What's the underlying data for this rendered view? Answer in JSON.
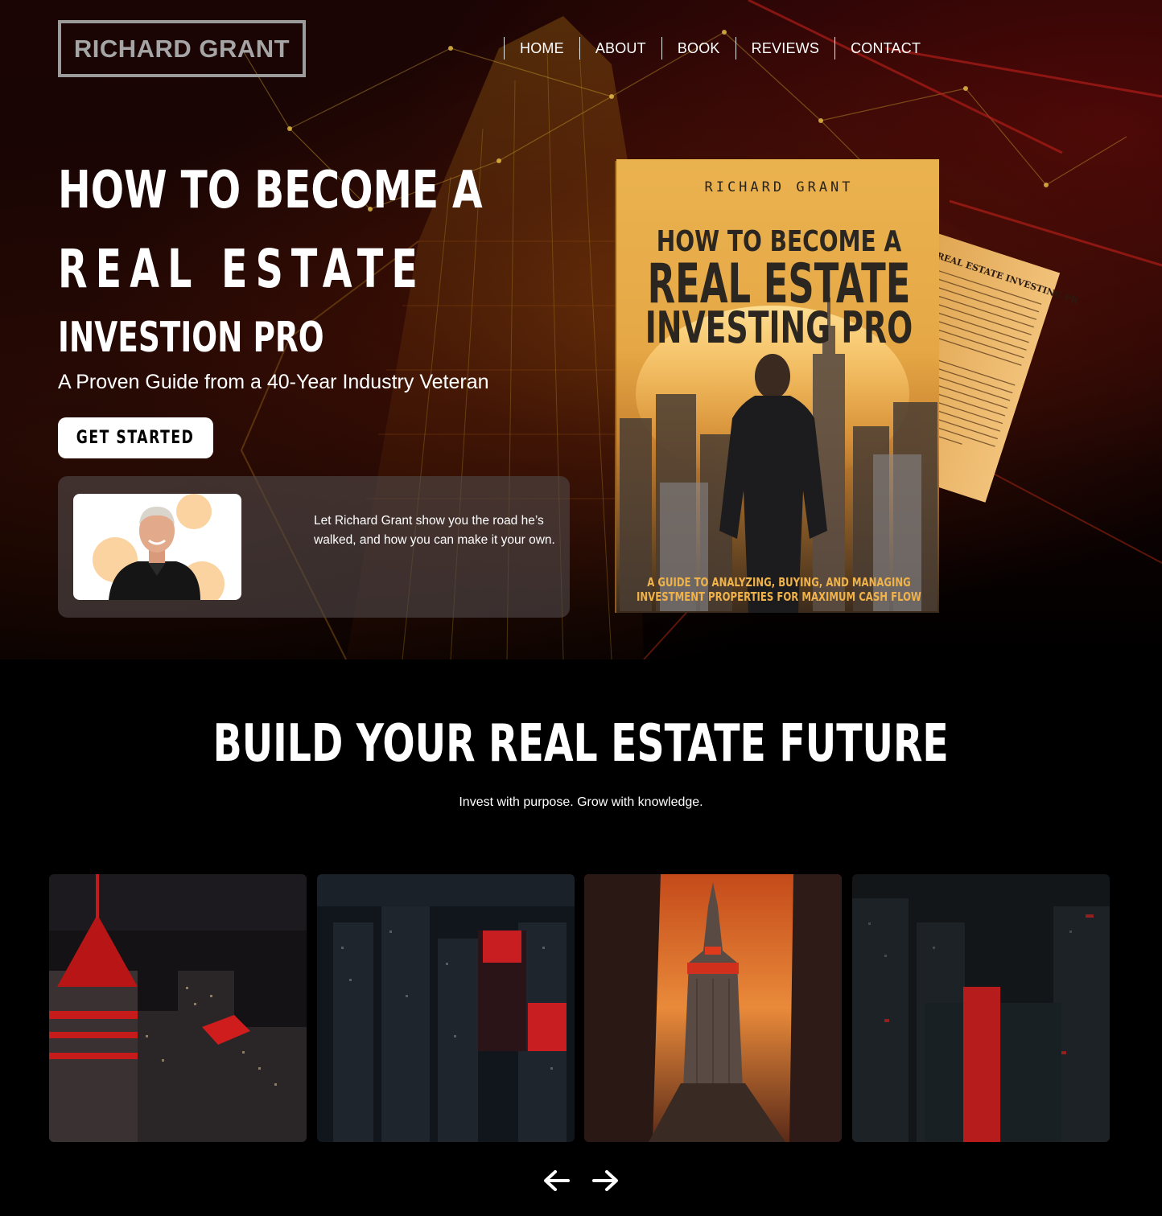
{
  "brand": {
    "logo_text": "RICHARD GRANT"
  },
  "nav": {
    "items": [
      {
        "label": "HOME"
      },
      {
        "label": "ABOUT"
      },
      {
        "label": "BOOK"
      },
      {
        "label": "REVIEWS"
      },
      {
        "label": "CONTACT"
      }
    ]
  },
  "hero": {
    "headline_line1": "HOW TO BECOME A",
    "headline_line2": "REAL ESTATE",
    "headline_line3": "INVESTION PRO",
    "subtitle": "A Proven Guide from a 40-Year Industry Veteran",
    "cta_label": "GET STARTED",
    "author_blurb": "Let Richard Grant show you the road he’s walked, and how you can make it your own."
  },
  "book": {
    "author": "RICHARD GRANT",
    "title_line1": "HOW TO BECOME A",
    "title_line2": "REAL ESTATE",
    "title_line3": "INVESTING PRO",
    "tagline_line1": "A GUIDE TO ANALYZING, BUYING, AND MANAGING",
    "tagline_line2": "INVESTMENT PROPERTIES FOR MAXIMUM CASH FLOW",
    "back_title": "REAL ESTATE INVESTING PRO"
  },
  "section": {
    "title": "BUILD YOUR REAL ESTATE FUTURE",
    "subtitle": "Invest with purpose. Grow with knowledge."
  },
  "gallery": {
    "prev_icon": "arrow-left-icon",
    "next_icon": "arrow-right-icon"
  },
  "colors": {
    "background": "#000000",
    "book_gold": "#e8ab48",
    "accent_red": "#d11a1a",
    "card_bg": "#504848"
  }
}
